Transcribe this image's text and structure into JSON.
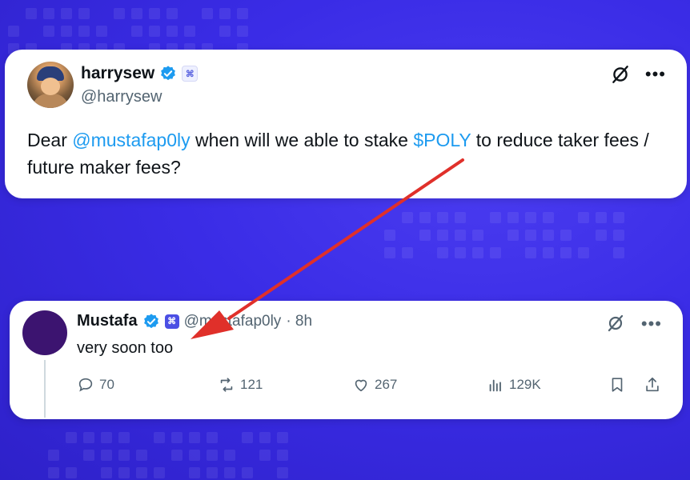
{
  "original_tweet": {
    "display_name": "harrysew",
    "handle": "@harrysew",
    "text_prefix": "Dear ",
    "mention": "@mustafap0ly",
    "text_middle": " when will we able to stake ",
    "cashtag": "$POLY",
    "text_suffix": " to reduce taker fees / future maker fees?"
  },
  "reply_tweet": {
    "display_name": "Mustafa",
    "handle": "@mustafap0ly",
    "time": " · 8h",
    "text": "very soon too",
    "replies": "70",
    "reposts": "121",
    "likes": "267",
    "views": "129K"
  },
  "colors": {
    "background": "#3a2ce6",
    "link": "#1d9bf0",
    "verified": "#1d9bf0",
    "annotation_arrow": "#e0302a"
  },
  "icons": [
    "verified-badge-icon",
    "affiliate-badge-icon",
    "grok-icon",
    "more-icon",
    "reply-icon",
    "repost-icon",
    "like-icon",
    "views-icon",
    "bookmark-icon",
    "share-icon"
  ]
}
